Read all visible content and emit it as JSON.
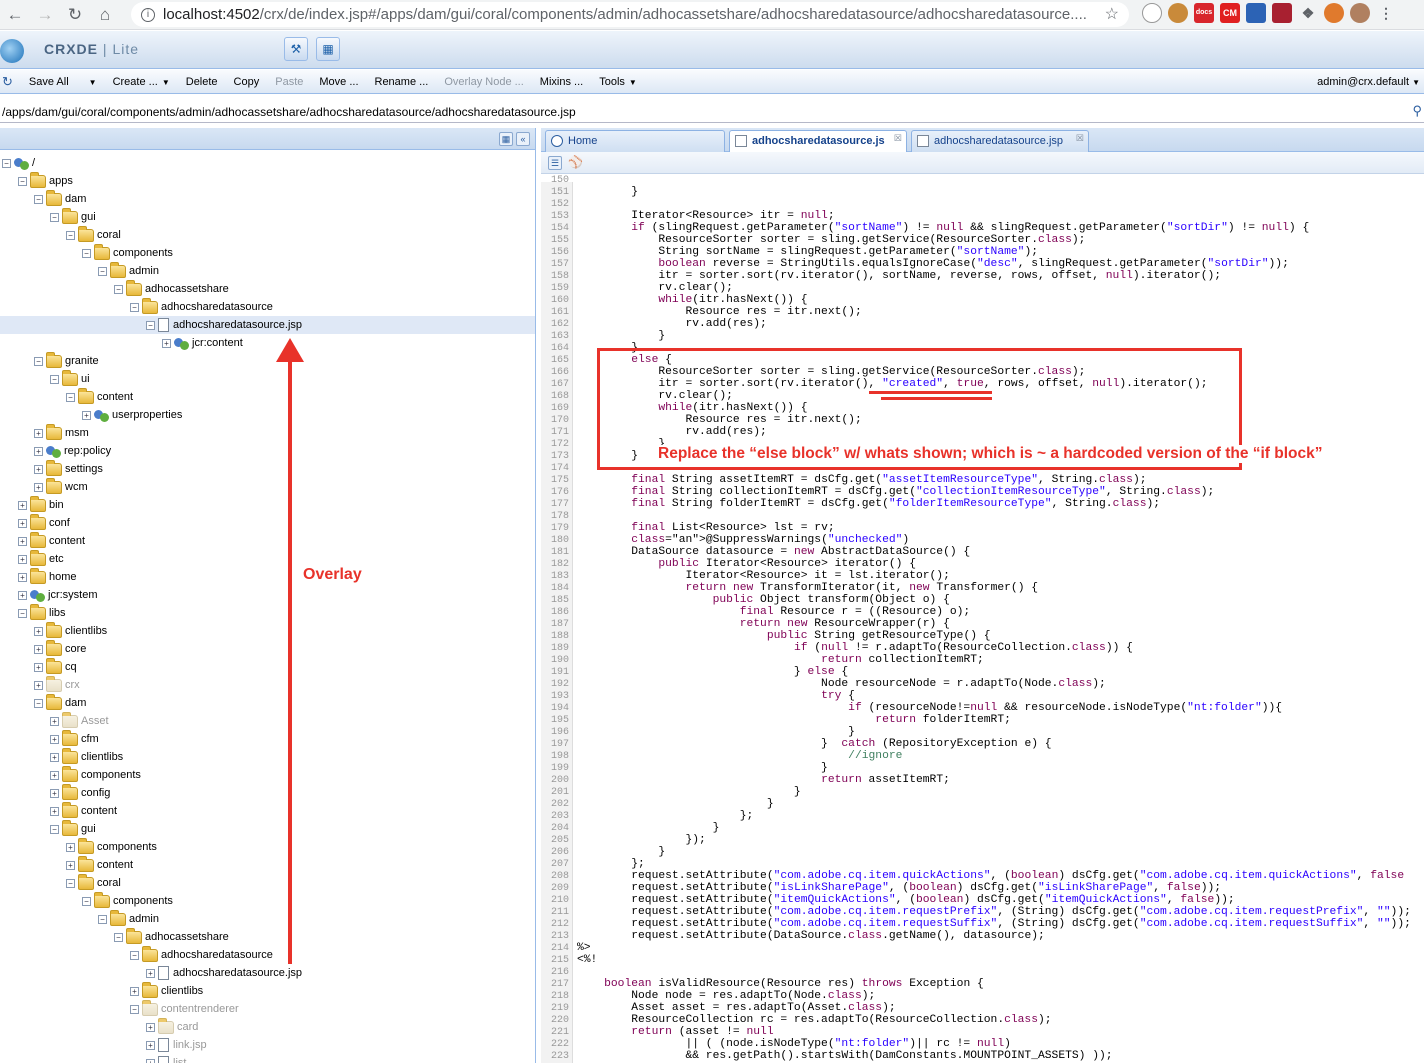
{
  "browser": {
    "url_host": "localhost:4502",
    "url_path": "/crx/de/index.jsp#/apps/dam/gui/coral/components/admin/adhocassetshare/adhocsharedatasource/adhocsharedatasource....",
    "extensions": [
      "docs",
      "CM"
    ]
  },
  "app": {
    "name_bold": "CRXDE",
    "name_light": "Lite"
  },
  "toolbar": {
    "items": [
      {
        "label": "Save All",
        "caret": true,
        "disabled": false
      },
      {
        "label": "Create ...",
        "caret": true,
        "disabled": false
      },
      {
        "label": "Delete",
        "caret": false,
        "disabled": false
      },
      {
        "label": "Copy",
        "caret": false,
        "disabled": false
      },
      {
        "label": "Paste",
        "caret": false,
        "disabled": true
      },
      {
        "label": "Move ...",
        "caret": false,
        "disabled": false
      },
      {
        "label": "Rename ...",
        "caret": false,
        "disabled": false
      },
      {
        "label": "Overlay Node ...",
        "caret": false,
        "disabled": true
      },
      {
        "label": "Mixins ...",
        "caret": false,
        "disabled": false
      },
      {
        "label": "Tools",
        "caret": true,
        "disabled": false
      }
    ],
    "user": "admin@crx.default"
  },
  "path": "/apps/dam/gui/coral/components/admin/adhocassetshare/adhocsharedatasource/adhocsharedatasource.jsp",
  "tree": [
    {
      "d": 0,
      "t": "minus",
      "i": "node",
      "label": "/"
    },
    {
      "d": 1,
      "t": "minus",
      "i": "folder",
      "label": "apps"
    },
    {
      "d": 2,
      "t": "minus",
      "i": "folder",
      "label": "dam"
    },
    {
      "d": 3,
      "t": "minus",
      "i": "folder",
      "label": "gui"
    },
    {
      "d": 4,
      "t": "minus",
      "i": "folder",
      "label": "coral"
    },
    {
      "d": 5,
      "t": "minus",
      "i": "folder",
      "label": "components"
    },
    {
      "d": 6,
      "t": "minus",
      "i": "folder",
      "label": "admin"
    },
    {
      "d": 7,
      "t": "minus",
      "i": "folder",
      "label": "adhocassetshare"
    },
    {
      "d": 8,
      "t": "minus",
      "i": "folder",
      "label": "adhocsharedatasource"
    },
    {
      "d": 9,
      "t": "minus",
      "i": "file",
      "label": "adhocsharedatasource.jsp",
      "sel": true
    },
    {
      "d": 10,
      "t": "plus",
      "i": "node",
      "label": "jcr:content"
    },
    {
      "d": 2,
      "t": "minus",
      "i": "folder",
      "label": "granite"
    },
    {
      "d": 3,
      "t": "minus",
      "i": "folder",
      "label": "ui"
    },
    {
      "d": 4,
      "t": "minus",
      "i": "folder",
      "label": "content"
    },
    {
      "d": 5,
      "t": "plus",
      "i": "node",
      "label": "userproperties"
    },
    {
      "d": 2,
      "t": "plus",
      "i": "folder",
      "label": "msm"
    },
    {
      "d": 2,
      "t": "plus",
      "i": "node",
      "label": "rep:policy"
    },
    {
      "d": 2,
      "t": "plus",
      "i": "folder",
      "label": "settings"
    },
    {
      "d": 2,
      "t": "plus",
      "i": "folder",
      "label": "wcm"
    },
    {
      "d": 1,
      "t": "plus",
      "i": "folder",
      "label": "bin"
    },
    {
      "d": 1,
      "t": "plus",
      "i": "folder",
      "label": "conf"
    },
    {
      "d": 1,
      "t": "plus",
      "i": "folder",
      "label": "content"
    },
    {
      "d": 1,
      "t": "plus",
      "i": "folder",
      "label": "etc"
    },
    {
      "d": 1,
      "t": "plus",
      "i": "folder",
      "label": "home"
    },
    {
      "d": 1,
      "t": "plus",
      "i": "node",
      "label": "jcr:system"
    },
    {
      "d": 1,
      "t": "minus",
      "i": "folder",
      "label": "libs"
    },
    {
      "d": 2,
      "t": "plus",
      "i": "folder",
      "label": "clientlibs"
    },
    {
      "d": 2,
      "t": "plus",
      "i": "folder",
      "label": "core"
    },
    {
      "d": 2,
      "t": "plus",
      "i": "folder",
      "label": "cq"
    },
    {
      "d": 2,
      "t": "plus",
      "i": "folder",
      "label": "crx",
      "dis": true
    },
    {
      "d": 2,
      "t": "minus",
      "i": "folder",
      "label": "dam"
    },
    {
      "d": 3,
      "t": "plus",
      "i": "folder",
      "label": "Asset",
      "dis": true
    },
    {
      "d": 3,
      "t": "plus",
      "i": "folder",
      "label": "cfm"
    },
    {
      "d": 3,
      "t": "plus",
      "i": "folder",
      "label": "clientlibs"
    },
    {
      "d": 3,
      "t": "plus",
      "i": "folder",
      "label": "components"
    },
    {
      "d": 3,
      "t": "plus",
      "i": "folder",
      "label": "config"
    },
    {
      "d": 3,
      "t": "plus",
      "i": "folder",
      "label": "content"
    },
    {
      "d": 3,
      "t": "minus",
      "i": "folder",
      "label": "gui"
    },
    {
      "d": 4,
      "t": "plus",
      "i": "folder",
      "label": "components"
    },
    {
      "d": 4,
      "t": "plus",
      "i": "folder",
      "label": "content"
    },
    {
      "d": 4,
      "t": "minus",
      "i": "folder",
      "label": "coral"
    },
    {
      "d": 5,
      "t": "minus",
      "i": "folder",
      "label": "components"
    },
    {
      "d": 6,
      "t": "minus",
      "i": "folder",
      "label": "admin"
    },
    {
      "d": 7,
      "t": "minus",
      "i": "folder",
      "label": "adhocassetshare"
    },
    {
      "d": 8,
      "t": "minus",
      "i": "folder",
      "label": "adhocsharedatasource"
    },
    {
      "d": 9,
      "t": "plus",
      "i": "file",
      "label": "adhocsharedatasource.jsp"
    },
    {
      "d": 8,
      "t": "plus",
      "i": "folder",
      "label": "clientlibs"
    },
    {
      "d": 8,
      "t": "minus",
      "i": "folder",
      "label": "contentrenderer",
      "dis": true
    },
    {
      "d": 9,
      "t": "plus",
      "i": "folder",
      "label": "card",
      "dis": true
    },
    {
      "d": 9,
      "t": "plus",
      "i": "file",
      "label": "link.jsp",
      "dis": true
    },
    {
      "d": 9,
      "t": "plus",
      "i": "file",
      "label": "list",
      "dis": true
    }
  ],
  "tabs": [
    {
      "label": "Home",
      "active": false
    },
    {
      "label": "adhocsharedatasource.js",
      "active": true
    },
    {
      "label": "adhocsharedatasource.jsp",
      "active": false
    }
  ],
  "code_lines": [
    {
      "n": "150",
      "t": ""
    },
    {
      "n": "151",
      "t": "        }"
    },
    {
      "n": "152",
      "t": ""
    },
    {
      "n": "153",
      "t": "        Iterator<Resource> itr = null;"
    },
    {
      "n": "154",
      "t": "        if (slingRequest.getParameter(\"sortName\") != null && slingRequest.getParameter(\"sortDir\") != null) {"
    },
    {
      "n": "155",
      "t": "            ResourceSorter sorter = sling.getService(ResourceSorter.class);"
    },
    {
      "n": "156",
      "t": "            String sortName = slingRequest.getParameter(\"sortName\");"
    },
    {
      "n": "157",
      "t": "            boolean reverse = StringUtils.equalsIgnoreCase(\"desc\", slingRequest.getParameter(\"sortDir\"));"
    },
    {
      "n": "158",
      "t": "            itr = sorter.sort(rv.iterator(), sortName, reverse, rows, offset, null).iterator();"
    },
    {
      "n": "159",
      "t": "            rv.clear();"
    },
    {
      "n": "160",
      "t": "            while(itr.hasNext()) {"
    },
    {
      "n": "161",
      "t": "                Resource res = itr.next();"
    },
    {
      "n": "162",
      "t": "                rv.add(res);"
    },
    {
      "n": "163",
      "t": "            }"
    },
    {
      "n": "164",
      "t": "        }"
    },
    {
      "n": "165",
      "t": "        else {"
    },
    {
      "n": "166",
      "t": "            ResourceSorter sorter = sling.getService(ResourceSorter.class);"
    },
    {
      "n": "167",
      "t": "            itr = sorter.sort(rv.iterator(), \"created\", true, rows, offset, null).iterator();"
    },
    {
      "n": "168",
      "t": "            rv.clear();"
    },
    {
      "n": "169",
      "t": "            while(itr.hasNext()) {"
    },
    {
      "n": "170",
      "t": "                Resource res = itr.next();"
    },
    {
      "n": "171",
      "t": "                rv.add(res);"
    },
    {
      "n": "172",
      "t": "            }"
    },
    {
      "n": "173",
      "t": "        }"
    },
    {
      "n": "174",
      "t": ""
    },
    {
      "n": "175",
      "t": "        final String assetItemRT = dsCfg.get(\"assetItemResourceType\", String.class);"
    },
    {
      "n": "176",
      "t": "        final String collectionItemRT = dsCfg.get(\"collectionItemResourceType\", String.class);"
    },
    {
      "n": "177",
      "t": "        final String folderItemRT = dsCfg.get(\"folderItemResourceType\", String.class);"
    },
    {
      "n": "178",
      "t": ""
    },
    {
      "n": "179",
      "t": "        final List<Resource> lst = rv;"
    },
    {
      "n": "180",
      "t": "        @SuppressWarnings(\"unchecked\")"
    },
    {
      "n": "181",
      "t": "        DataSource datasource = new AbstractDataSource() {"
    },
    {
      "n": "182",
      "t": "            public Iterator<Resource> iterator() {"
    },
    {
      "n": "183",
      "t": "                Iterator<Resource> it = lst.iterator();"
    },
    {
      "n": "184",
      "t": "                return new TransformIterator(it, new Transformer() {"
    },
    {
      "n": "185",
      "t": "                    public Object transform(Object o) {"
    },
    {
      "n": "186",
      "t": "                        final Resource r = ((Resource) o);"
    },
    {
      "n": "187",
      "t": "                        return new ResourceWrapper(r) {"
    },
    {
      "n": "188",
      "t": "                            public String getResourceType() {"
    },
    {
      "n": "189",
      "t": "                                if (null != r.adaptTo(ResourceCollection.class)) {"
    },
    {
      "n": "190",
      "t": "                                    return collectionItemRT;"
    },
    {
      "n": "191",
      "t": "                                } else {"
    },
    {
      "n": "192",
      "t": "                                    Node resourceNode = r.adaptTo(Node.class);"
    },
    {
      "n": "193",
      "t": "                                    try {"
    },
    {
      "n": "194",
      "t": "                                        if (resourceNode!=null && resourceNode.isNodeType(\"nt:folder\")){"
    },
    {
      "n": "195",
      "t": "                                            return folderItemRT;"
    },
    {
      "n": "196",
      "t": "                                        }"
    },
    {
      "n": "197",
      "t": "                                    }  catch (RepositoryException e) {"
    },
    {
      "n": "198",
      "t": "                                        //ignore"
    },
    {
      "n": "199",
      "t": "                                    }"
    },
    {
      "n": "200",
      "t": "                                    return assetItemRT;"
    },
    {
      "n": "201",
      "t": "                                }"
    },
    {
      "n": "202",
      "t": "                            }"
    },
    {
      "n": "203",
      "t": "                        };"
    },
    {
      "n": "204",
      "t": "                    }"
    },
    {
      "n": "205",
      "t": "                });"
    },
    {
      "n": "206",
      "t": "            }"
    },
    {
      "n": "207",
      "t": "        };"
    },
    {
      "n": "208",
      "t": "        request.setAttribute(\"com.adobe.cq.item.quickActions\", (boolean) dsCfg.get(\"com.adobe.cq.item.quickActions\", false"
    },
    {
      "n": "209",
      "t": "        request.setAttribute(\"isLinkSharePage\", (boolean) dsCfg.get(\"isLinkSharePage\", false));"
    },
    {
      "n": "210",
      "t": "        request.setAttribute(\"itemQuickActions\", (boolean) dsCfg.get(\"itemQuickActions\", false));"
    },
    {
      "n": "211",
      "t": "        request.setAttribute(\"com.adobe.cq.item.requestPrefix\", (String) dsCfg.get(\"com.adobe.cq.item.requestPrefix\", \"\"));"
    },
    {
      "n": "212",
      "t": "        request.setAttribute(\"com.adobe.cq.item.requestSuffix\", (String) dsCfg.get(\"com.adobe.cq.item.requestSuffix\", \"\"));"
    },
    {
      "n": "213",
      "t": "        request.setAttribute(DataSource.class.getName(), datasource);"
    },
    {
      "n": "214",
      "t": "%>"
    },
    {
      "n": "215",
      "t": "<%!"
    },
    {
      "n": "216",
      "t": ""
    },
    {
      "n": "217",
      "t": "    boolean isValidResource(Resource res) throws Exception {"
    },
    {
      "n": "218",
      "t": "        Node node = res.adaptTo(Node.class);"
    },
    {
      "n": "219",
      "t": "        Asset asset = res.adaptTo(Asset.class);"
    },
    {
      "n": "220",
      "t": "        ResourceCollection rc = res.adaptTo(ResourceCollection.class);"
    },
    {
      "n": "221",
      "t": "        return (asset != null"
    },
    {
      "n": "222",
      "t": "                || ( (node.isNodeType(\"nt:folder\")|| rc != null)"
    },
    {
      "n": "223",
      "t": "                && res.getPath().startsWith(DamConstants.MOUNTPOINT_ASSETS) ));"
    }
  ],
  "annotations": {
    "note": "Replace the “else block” w/ whats shown; which is ~ a hardcoded version of the “if block”",
    "overlay": "Overlay"
  }
}
